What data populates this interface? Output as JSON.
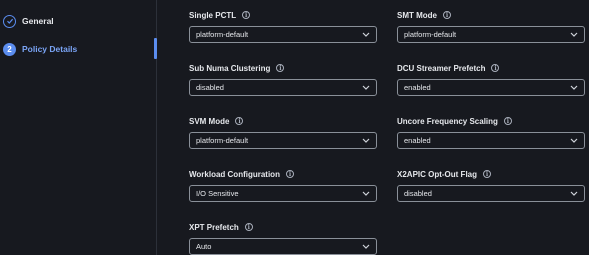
{
  "sidebar": {
    "steps": [
      {
        "label": "General",
        "state": "done",
        "marker": "✓"
      },
      {
        "label": "Policy Details",
        "state": "current",
        "marker": "2"
      }
    ]
  },
  "form": {
    "fields": [
      {
        "label": "Single PCTL",
        "value": "platform-default"
      },
      {
        "label": "SMT Mode",
        "value": "platform-default"
      },
      {
        "label": "Sub Numa Clustering",
        "value": "disabled"
      },
      {
        "label": "DCU Streamer Prefetch",
        "value": "enabled"
      },
      {
        "label": "SVM Mode",
        "value": "platform-default"
      },
      {
        "label": "Uncore Frequency Scaling",
        "value": "enabled"
      },
      {
        "label": "Workload Configuration",
        "value": "I/O Sensitive"
      },
      {
        "label": "X2APIC Opt-Out Flag",
        "value": "disabled"
      },
      {
        "label": "XPT Prefetch",
        "value": "Auto"
      }
    ],
    "info_icon_glyph": "i"
  },
  "colors": {
    "accent": "#5b8def",
    "background": "#17191f",
    "border": "#8a9099"
  }
}
